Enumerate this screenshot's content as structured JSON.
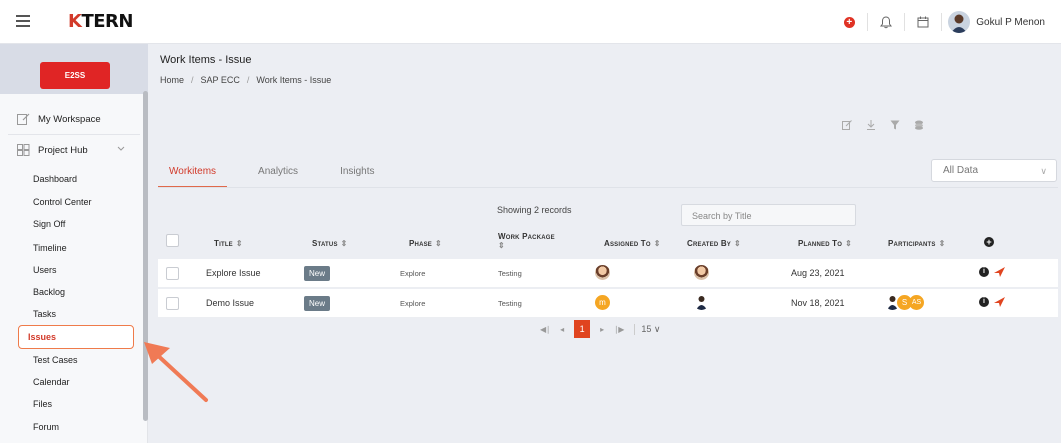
{
  "topbar": {
    "logo_k": "K",
    "logo_rest": "TERN",
    "user_name": "Gokul P Menon"
  },
  "sidebar": {
    "org_label": "E2SS",
    "my_workspace": "My Workspace",
    "project_hub": "Project Hub",
    "items": [
      "Dashboard",
      "Control Center",
      "Sign Off",
      "Timeline",
      "Users",
      "Backlog",
      "Tasks",
      "Issues",
      "Test Cases",
      "Calendar",
      "Files",
      "Forum"
    ],
    "active_item": "Issues"
  },
  "page": {
    "title": "Work Items - Issue",
    "breadcrumb": [
      "Home",
      "SAP ECC",
      "Work Items - Issue"
    ]
  },
  "tabs": [
    "Workitems",
    "Analytics",
    "Insights"
  ],
  "active_tab": "Workitems",
  "filter_select": "All Data",
  "records_text": "Showing 2 records",
  "search_placeholder": "Search by Title",
  "columns": {
    "title": "Title",
    "status": "Status",
    "phase": "Phase",
    "work_package": "Work Package",
    "assigned_to": "Assigned To",
    "created_by": "Created By",
    "planned_to": "Planned To",
    "participants": "Participants"
  },
  "rows": [
    {
      "title": "Explore Issue",
      "status": "New",
      "phase": "Explore",
      "work_package": "Testing",
      "planned_to": "Aug 23, 2021"
    },
    {
      "title": "Demo Issue",
      "status": "New",
      "phase": "Explore",
      "work_package": "Testing",
      "assigned_initial": "m",
      "planned_to": "Nov 18, 2021",
      "participant_initials": [
        "S",
        "AS"
      ]
    }
  ],
  "pager": {
    "current": "1",
    "page_size": "15"
  },
  "colors": {
    "accent": "#e0441f",
    "brand_red": "#e02525",
    "status_badge": "#6b7b88"
  }
}
